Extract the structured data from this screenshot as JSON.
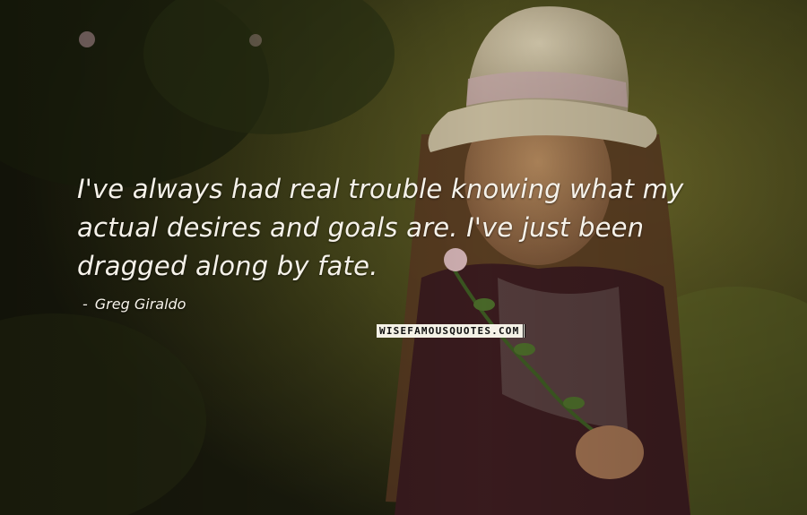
{
  "quote": {
    "text": "I've always had real trouble knowing what my actual desires and goals are. I've just been dragged along by fate.",
    "author": "Greg Giraldo",
    "dash": "-"
  },
  "watermark": {
    "text": "WISEFAMOUSQUOTES.COM"
  },
  "colors": {
    "text": "#f6f2ea",
    "background_dark": "#1d1c10",
    "background_olive": "#6b6524"
  }
}
